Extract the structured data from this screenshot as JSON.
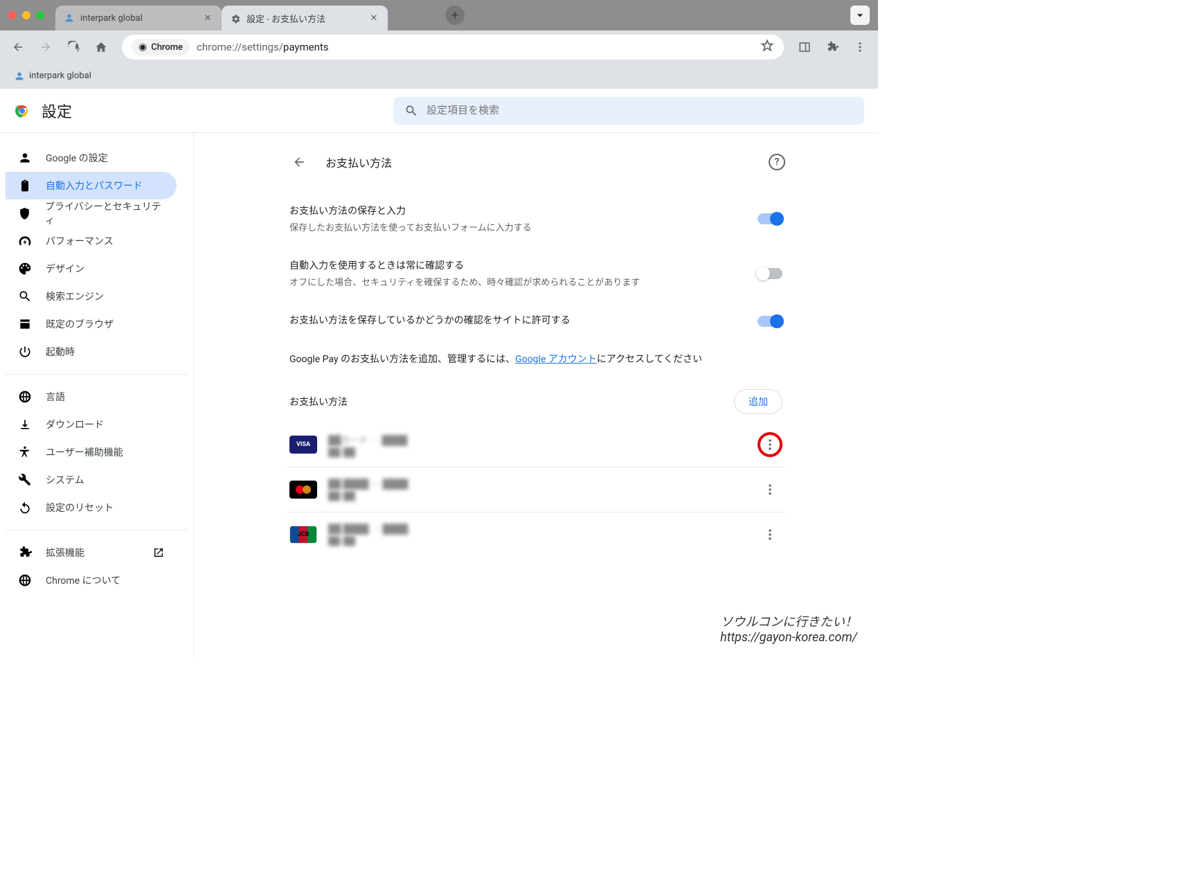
{
  "tabs": [
    {
      "title": "interpark global",
      "active": false
    },
    {
      "title": "設定 - お支払い方法",
      "active": true
    }
  ],
  "omnibox": {
    "chip": "Chrome",
    "host": "chrome://settings/",
    "path": "payments"
  },
  "bookmarks": [
    {
      "title": "interpark global"
    }
  ],
  "settings": {
    "title": "設定",
    "search_placeholder": "設定項目を検索",
    "sidebar": [
      {
        "id": "google",
        "label": "Google の設定",
        "icon": "person"
      },
      {
        "id": "autofill",
        "label": "自動入力とパスワード",
        "icon": "clipboard",
        "active": true
      },
      {
        "id": "privacy",
        "label": "プライバシーとセキュリティ",
        "icon": "shield"
      },
      {
        "id": "performance",
        "label": "パフォーマンス",
        "icon": "speed"
      },
      {
        "id": "design",
        "label": "デザイン",
        "icon": "palette"
      },
      {
        "id": "search",
        "label": "検索エンジン",
        "icon": "search"
      },
      {
        "id": "default",
        "label": "既定のブラウザ",
        "icon": "window"
      },
      {
        "id": "startup",
        "label": "起動時",
        "icon": "power"
      }
    ],
    "sidebar2": [
      {
        "id": "lang",
        "label": "言語",
        "icon": "globe"
      },
      {
        "id": "download",
        "label": "ダウンロード",
        "icon": "download"
      },
      {
        "id": "a11y",
        "label": "ユーザー補助機能",
        "icon": "a11y"
      },
      {
        "id": "system",
        "label": "システム",
        "icon": "wrench"
      },
      {
        "id": "reset",
        "label": "設定のリセット",
        "icon": "reset"
      }
    ],
    "sidebar3": [
      {
        "id": "ext",
        "label": "拡張機能",
        "icon": "puzzle",
        "external": true
      },
      {
        "id": "about",
        "label": "Chrome について",
        "icon": "chrome"
      }
    ],
    "page": {
      "title": "お支払い方法",
      "rows": [
        {
          "title": "お支払い方法の保存と入力",
          "sub": "保存したお支払い方法を使ってお支払いフォームに入力する",
          "toggle": true
        },
        {
          "title": "自動入力を使用するときは常に確認する",
          "sub": "オフにした場合、セキュリティを確保するため、時々確認が求められることがあります",
          "toggle": false
        },
        {
          "title": "お支払い方法を保存しているかどうかの確認をサイトに許可する",
          "sub": "",
          "toggle": true
        }
      ],
      "gpay_prefix": "Google Pay のお支払い方法を追加、管理するには、",
      "gpay_link": "Google アカウント",
      "gpay_suffix": "にアクセスしてください",
      "cards_title": "お支払い方法",
      "add_label": "追加",
      "cards": [
        {
          "brand": "visa",
          "name": "██カード ···· ████",
          "exp": "██/██",
          "highlight": true
        },
        {
          "brand": "mc",
          "name": "██ ████ ···· ████",
          "exp": "██/██"
        },
        {
          "brand": "jcb",
          "name": "██ ████ ···· ████",
          "exp": "██/██"
        }
      ]
    }
  },
  "watermark": {
    "line1": "ソウルコンに行きたい！",
    "line2": "https://gayon-korea.com/"
  }
}
